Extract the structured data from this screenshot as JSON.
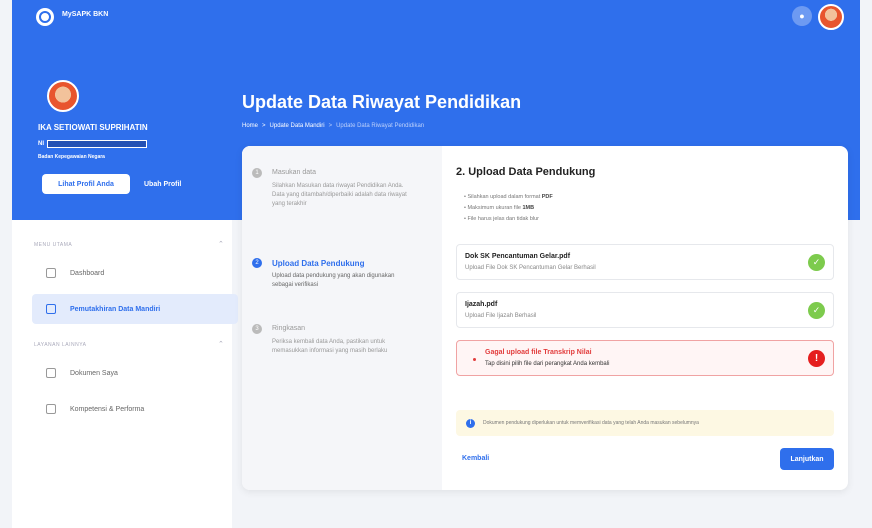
{
  "app": {
    "name": "MySAPK BKN"
  },
  "profile": {
    "name": "IKA SETIOWATI SUPRIHATIN",
    "nip_label": "NI",
    "org": "Badan Kepegawaian Negara",
    "view_profile": "Lihat Profil Anda",
    "edit_profile": "Ubah Profil"
  },
  "page": {
    "title": "Update Data Riwayat Pendidikan",
    "breadcrumb": [
      "Home",
      "Update Data Mandiri",
      "Update Data Riwayat Pendidikan"
    ],
    "separator": ">"
  },
  "sidebar": {
    "section1": "MENU UTAMA",
    "items1": [
      "Dashboard",
      "Pemutakhiran Data Mandiri"
    ],
    "section2": "LAYANAN LAINNYA",
    "items2": [
      "Dokumen Saya",
      "Kompetensi & Performa"
    ]
  },
  "steps": [
    {
      "num": "1",
      "title": "Masukan data",
      "desc": "Silahkan Masukan data riwayat Pendidikan Anda. Data yang ditambah/diperbaiki adalah data riwayat yang terakhir"
    },
    {
      "num": "2",
      "title": "Upload Data Pendukung",
      "desc": "Upload data pendukung yang akan digunakan sebagai verifikasi"
    },
    {
      "num": "3",
      "title": "Ringkasan",
      "desc": "Periksa kembali data Anda, pastikan untuk memasukkan informasi yang masih berlaku"
    }
  ],
  "upload": {
    "title": "2. Upload Data Pendukung",
    "rule1_pre": "Silahkan upload dalam format ",
    "rule1_bold": "PDF",
    "rule2_pre": "Maksimum ukuran file ",
    "rule2_bold": "1MB",
    "rule3": "File harus jelas dan tidak blur",
    "files": [
      {
        "name": "Dok SK Pencantuman Gelar.pdf",
        "sub": "Upload File Dok SK Pencantuman Gelar Berhasil"
      },
      {
        "name": "Ijazah.pdf",
        "sub": "Upload File Ijazah Berhasil"
      }
    ],
    "error": {
      "title": "Gagal upload file Transkrip Nilai",
      "sub": "Tap disini pilih file dari perangkat Anda kembali"
    },
    "info": "Dokumen pendukung diperlukan untuk memverifikasi data yang telah Anda masukan sebelumnya",
    "back": "Kembali",
    "next": "Lanjutkan"
  },
  "icons": {
    "ok": "✓",
    "error": "!",
    "info": "i",
    "bell": "●"
  },
  "colors": {
    "primary": "#2f6fec",
    "success": "#7dcb4d",
    "danger": "#e51f1f"
  }
}
